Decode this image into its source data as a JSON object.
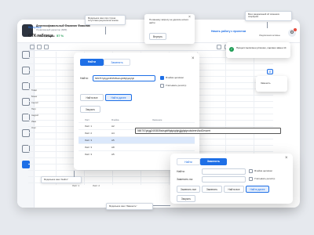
{
  "header": {
    "user_name": "Длинноофамильный Фамилия Фамилия",
    "user_role": "Управляющий директор (ЗМ0)",
    "kpi_label": "KPI по продажам",
    "kpi_value": "57 %",
    "start_work": "Начать работу с проектом",
    "notif_label": "Уведомления активны"
  },
  "page": {
    "back_link": "Вернуться",
    "title": "ОТК таблица"
  },
  "grid": {
    "row_labels": [
      "Товар",
      "Бланк",
      "Сергей",
      "Петр",
      "Андрей",
      "Иван",
      "Олег"
    ],
    "sheets": [
      "Лист 1",
      "Лист 2"
    ]
  },
  "search_popup": {
    "label": "Заменить"
  },
  "find_dialog": {
    "tab_find": "Найти",
    "tab_replace": "Заменить",
    "find_label": "Найти:",
    "find_value": "565757ghjgj2453535sdsgfdffgfgdgfgh",
    "whole_cell": "Ячейка целиком",
    "match_case": "Учитывать регистр",
    "btn_find_all": "Найти все",
    "btn_find_next": "Найти далее",
    "btn_close": "Закрыть",
    "columns": [
      "Лист",
      "Ячейка",
      "Значение"
    ],
    "rows": [
      {
        "sheet": "Лист 1",
        "cell": "A2",
        "value": "—"
      },
      {
        "sheet": "Лист 2",
        "cell": "A4",
        "value": "—"
      },
      {
        "sheet": "Лист 3",
        "cell": "A5",
        "value": "—"
      },
      {
        "sheet": "Лист 3",
        "cell": "A8",
        "value": "—"
      },
      {
        "sheet": "Лист 3",
        "cell": "A5",
        "value": "—"
      }
    ]
  },
  "tooltip_value": "565757ghjgj2453535sdsgfdffgfgdgfghjjjjgfgfgrsdsdeertAsdDeszert",
  "replace_dialog": {
    "tab_find": "Найти",
    "tab_replace": "Заменить",
    "find_label": "Найти:",
    "replace_label": "Заменить на:",
    "whole_cell": "Ячейка целиком",
    "match_case": "Учитывать регистр",
    "btn_replace_all": "Заменить все",
    "btn_replace": "Заменить",
    "btn_find_all": "Найти все",
    "btn_find_next": "Найти далее",
    "btn_close": "Закрыть"
  },
  "notes": {
    "top_left": "Модальное окно при случае отсутствия результатов поиска",
    "top_right": "Всех уведомлений об отвшиеся операциях",
    "left_bottom": "Модальное окно \"Найти\"",
    "bottom_center": "Модальное окно \"Заменить\""
  },
  "popup_notice": {
    "text": "По вашему запросу не удалось ничего найти",
    "button": "Вернуть"
  },
  "toast": {
    "text": "Процесс выполнен успешно, сделано замен 14"
  }
}
